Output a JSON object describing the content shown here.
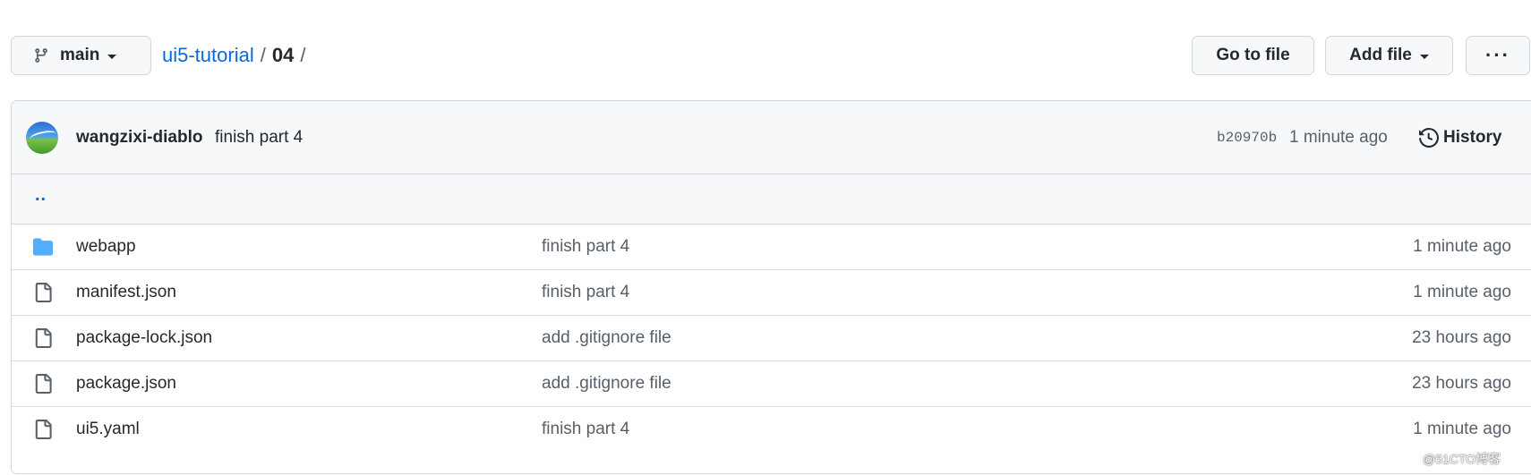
{
  "branch": {
    "label": "main",
    "icon": "git-branch-icon"
  },
  "breadcrumb": {
    "repo": "ui5-tutorial",
    "separator": "/",
    "dir": "04",
    "trailing": "/"
  },
  "toolbar": {
    "goto_file": "Go to file",
    "add_file": "Add file",
    "more": "···"
  },
  "latest_commit": {
    "author": "wangzixi-diablo",
    "message": "finish part 4",
    "sha": "b20970b",
    "time": "1 minute ago",
    "history_label": "History"
  },
  "parent_dir": "..",
  "files": [
    {
      "type": "folder",
      "icon": "folder-icon",
      "name": "webapp",
      "message": "finish part 4",
      "time": "1 minute ago"
    },
    {
      "type": "file",
      "icon": "file-icon",
      "name": "manifest.json",
      "message": "finish part 4",
      "time": "1 minute ago"
    },
    {
      "type": "file",
      "icon": "file-icon",
      "name": "package-lock.json",
      "message": "add .gitignore file",
      "time": "23 hours ago"
    },
    {
      "type": "file",
      "icon": "file-icon",
      "name": "package.json",
      "message": "add .gitignore file",
      "time": "23 hours ago"
    },
    {
      "type": "file",
      "icon": "file-icon",
      "name": "ui5.yaml",
      "message": "finish part 4",
      "time": "1 minute ago"
    }
  ],
  "watermark": "@51CTO博客",
  "colors": {
    "link": "#0969da",
    "folder": "#54aeff",
    "muted": "#57606a",
    "border": "#d0d7de"
  }
}
